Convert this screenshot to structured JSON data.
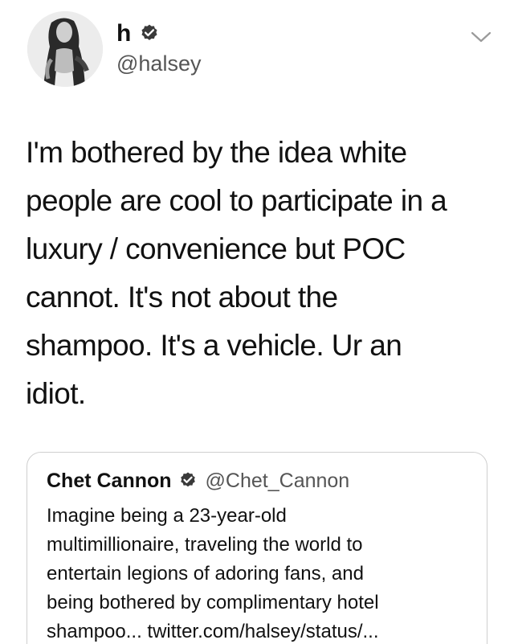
{
  "tweet": {
    "author": {
      "display_name": "h",
      "handle": "@halsey",
      "verified_icon": "verified-badge-icon",
      "avatar_icon": "avatar-photo"
    },
    "menu_icon": "chevron-down-icon",
    "text_lines": [
      "I'm bothered by the idea white",
      "people are cool to participate in a",
      "luxury / convenience but POC",
      "cannot. It's not about the",
      "shampoo. It's a vehicle. Ur an",
      "idiot."
    ]
  },
  "quoted_tweet": {
    "author": {
      "display_name": "Chet Cannon",
      "handle": "@Chet_Cannon",
      "verified_icon": "verified-badge-icon"
    },
    "text_lines": [
      "Imagine being a 23-year-old",
      "multimillionaire, traveling the world to",
      "entertain legions of adoring fans, and",
      "being bothered by complimentary hotel",
      "shampoo... twitter.com/halsey/status/..."
    ]
  },
  "colors": {
    "text": "#111111",
    "secondary_text": "#555555",
    "border": "#cfcfcf",
    "background": "#ffffff"
  }
}
